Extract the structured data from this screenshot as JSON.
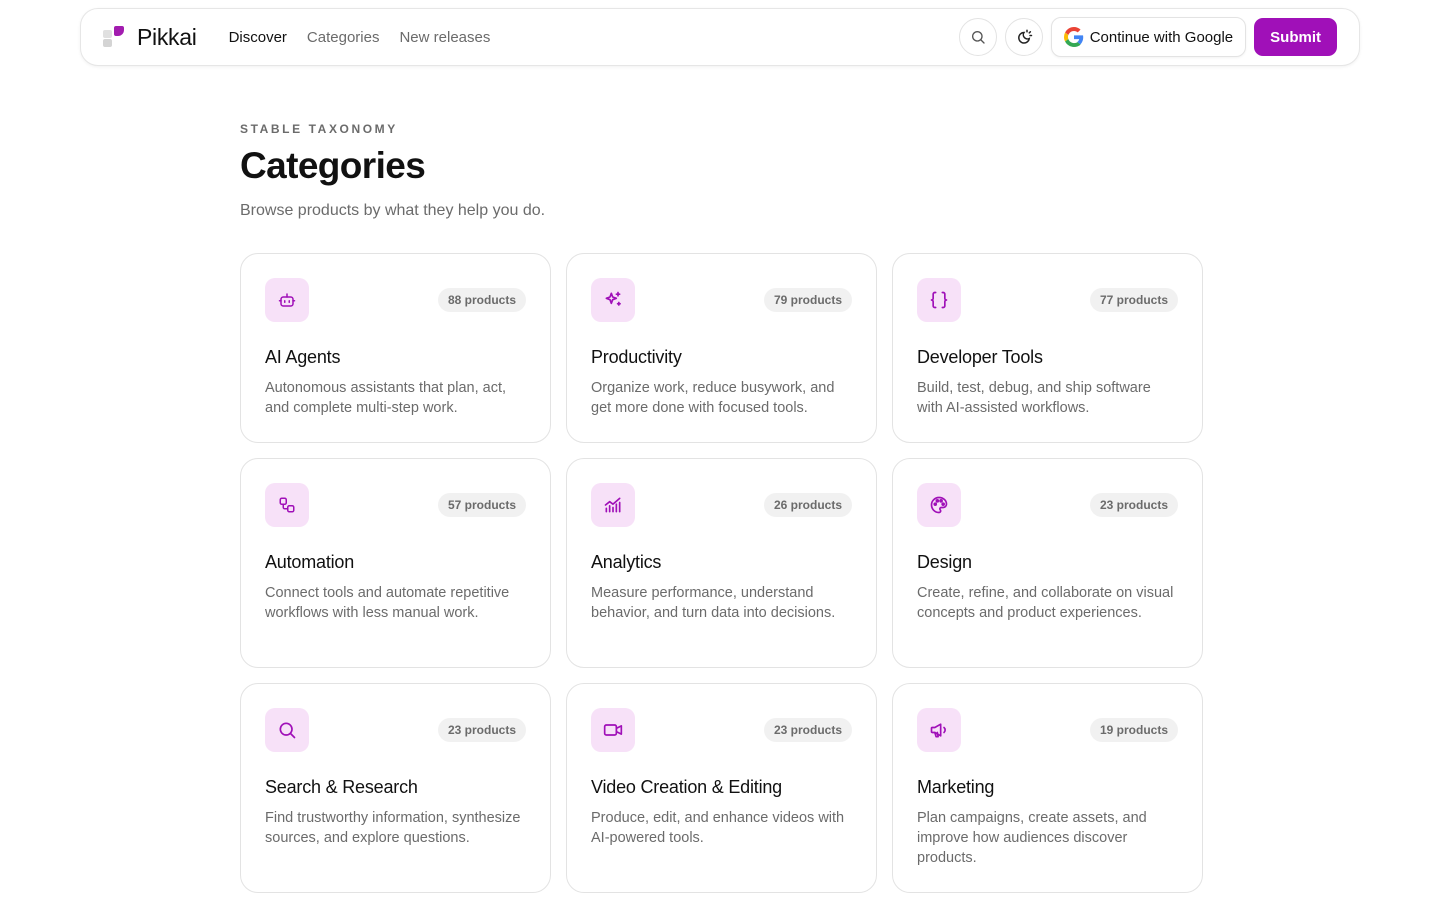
{
  "brand": {
    "name": "Pikkai",
    "accent": "#a010b8"
  },
  "nav": {
    "links": [
      {
        "label": "Discover",
        "active": true
      },
      {
        "label": "Categories",
        "active": false
      },
      {
        "label": "New releases",
        "active": false
      }
    ],
    "search_icon": "search-icon",
    "theme_icon": "theme-toggle-icon",
    "google_label": "Continue with Google",
    "submit_label": "Submit"
  },
  "header": {
    "eyebrow": "STABLE TAXONOMY",
    "title": "Categories",
    "subtitle": "Browse products by what they help you do."
  },
  "categories": [
    {
      "icon": "robot-icon",
      "count": "88 products",
      "title": "AI Agents",
      "desc": "Autonomous assistants that plan, act, and complete multi-step work."
    },
    {
      "icon": "sparkles-icon",
      "count": "79 products",
      "title": "Productivity",
      "desc": "Organize work, reduce busywork, and get more done with focused tools."
    },
    {
      "icon": "braces-icon",
      "count": "77 products",
      "title": "Developer Tools",
      "desc": "Build, test, debug, and ship software with AI-assisted workflows."
    },
    {
      "icon": "workflow-icon",
      "count": "57 products",
      "title": "Automation",
      "desc": "Connect tools and automate repetitive workflows with less manual work."
    },
    {
      "icon": "chart-icon",
      "count": "26 products",
      "title": "Analytics",
      "desc": "Measure performance, understand behavior, and turn data into decisions."
    },
    {
      "icon": "palette-icon",
      "count": "23 products",
      "title": "Design",
      "desc": "Create, refine, and collaborate on visual concepts and product experiences."
    },
    {
      "icon": "search-icon",
      "count": "23 products",
      "title": "Search & Research",
      "desc": "Find trustworthy information, synthesize sources, and explore questions."
    },
    {
      "icon": "video-icon",
      "count": "23 products",
      "title": "Video Creation & Editing",
      "desc": "Produce, edit, and enhance videos with AI-powered tools."
    },
    {
      "icon": "megaphone-icon",
      "count": "19 products",
      "title": "Marketing",
      "desc": "Plan campaigns, create assets, and improve how audiences discover products."
    }
  ]
}
